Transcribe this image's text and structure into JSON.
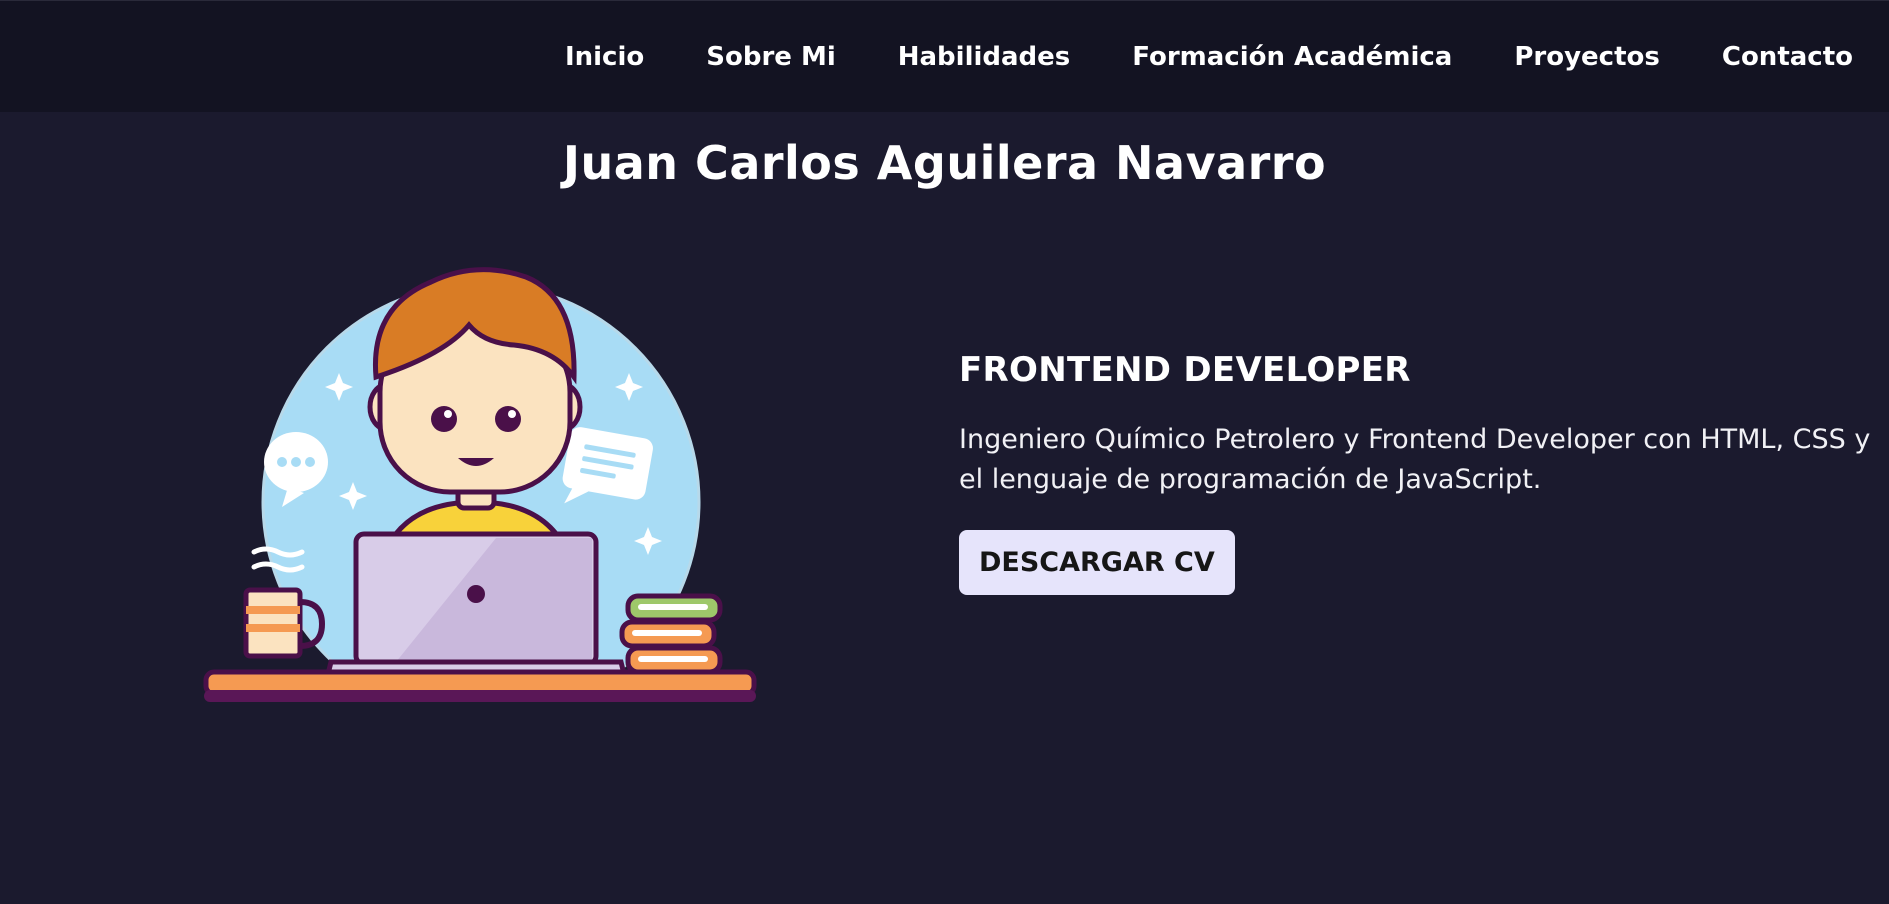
{
  "nav": {
    "items": [
      {
        "label": "Inicio"
      },
      {
        "label": "Sobre Mi"
      },
      {
        "label": "Habilidades"
      },
      {
        "label": "Formación Académica"
      },
      {
        "label": "Proyectos"
      },
      {
        "label": "Contacto"
      }
    ]
  },
  "hero": {
    "name": "Juan Carlos Aguilera Navarro",
    "role": "FRONTEND DEVELOPER",
    "description": "Ingeniero Químico Petrolero y Frontend Developer con HTML, CSS y el lenguaje de programación de JavaScript.",
    "cv_button_label": "DESCARGAR CV"
  },
  "colors": {
    "background": "#1b1a2e",
    "navbar": "#131322",
    "button_bg": "#e6e4fb",
    "text": "#ffffff"
  },
  "icons": {
    "illustration": "developer-at-laptop-illustration"
  }
}
